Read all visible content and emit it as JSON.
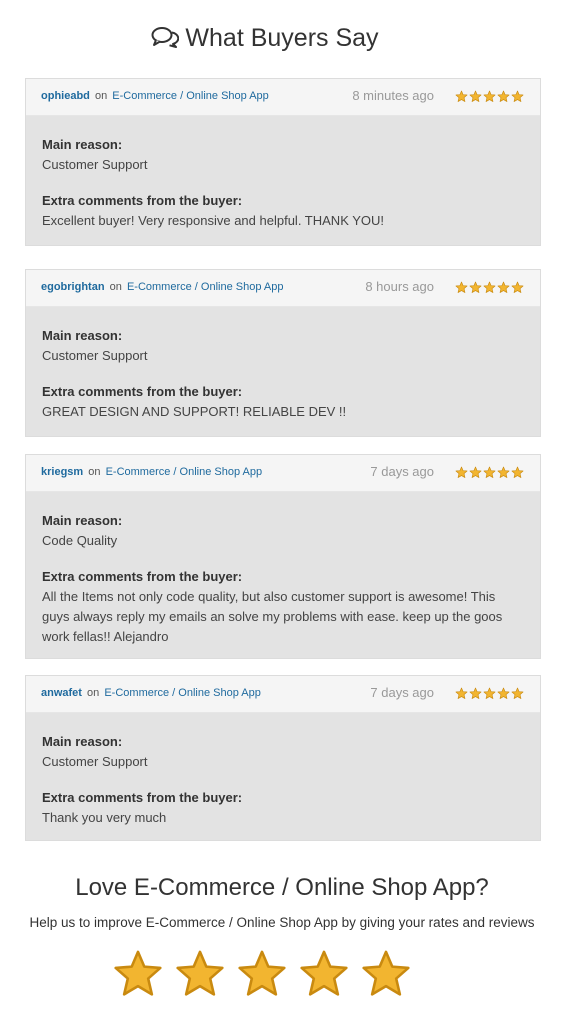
{
  "header": {
    "title": "What Buyers Say",
    "icon": "chat-bubbles-icon"
  },
  "reviews": [
    {
      "buyer": "ophieabd",
      "on": "on",
      "app": "E-Commerce / Online Shop App",
      "time": "8 minutes ago",
      "rating": 5,
      "main_reason_label": "Main reason:",
      "main_reason": "Customer Support",
      "comments_label": "Extra comments from the buyer:",
      "comments": "Excellent buyer! Very responsive and helpful. THANK YOU!"
    },
    {
      "buyer": "egobrightan",
      "on": "on",
      "app": "E-Commerce / Online Shop App",
      "time": "8 hours ago",
      "rating": 5,
      "main_reason_label": "Main reason:",
      "main_reason": "Customer Support",
      "comments_label": "Extra comments from the buyer:",
      "comments": "GREAT DESIGN AND SUPPORT! RELIABLE DEV !!"
    },
    {
      "buyer": "kriegsm",
      "on": "on",
      "app": "E-Commerce / Online Shop App",
      "time": "7 days ago",
      "rating": 5,
      "main_reason_label": "Main reason:",
      "main_reason": "Code Quality",
      "comments_label": "Extra comments from the buyer:",
      "comments": "All the Items not only code quality, but also customer support is awesome! This guys always reply my emails an solve my problems with ease. keep up the goos work fellas!! Alejandro"
    },
    {
      "buyer": "anwafet",
      "on": "on",
      "app": "E-Commerce / Online Shop App",
      "time": "7 days ago",
      "rating": 5,
      "main_reason_label": "Main reason:",
      "main_reason": "Customer Support",
      "comments_label": "Extra comments from the buyer:",
      "comments": "Thank you very much"
    }
  ],
  "footer": {
    "title": "Love E-Commerce / Online Shop App?",
    "subtitle": "Help us to improve E-Commerce / Online Shop App by giving your rates and reviews",
    "rating_stars": 5
  },
  "colors": {
    "star_fill": "#f2b530",
    "star_stroke": "#c98a10",
    "link": "#1f6a9e"
  }
}
